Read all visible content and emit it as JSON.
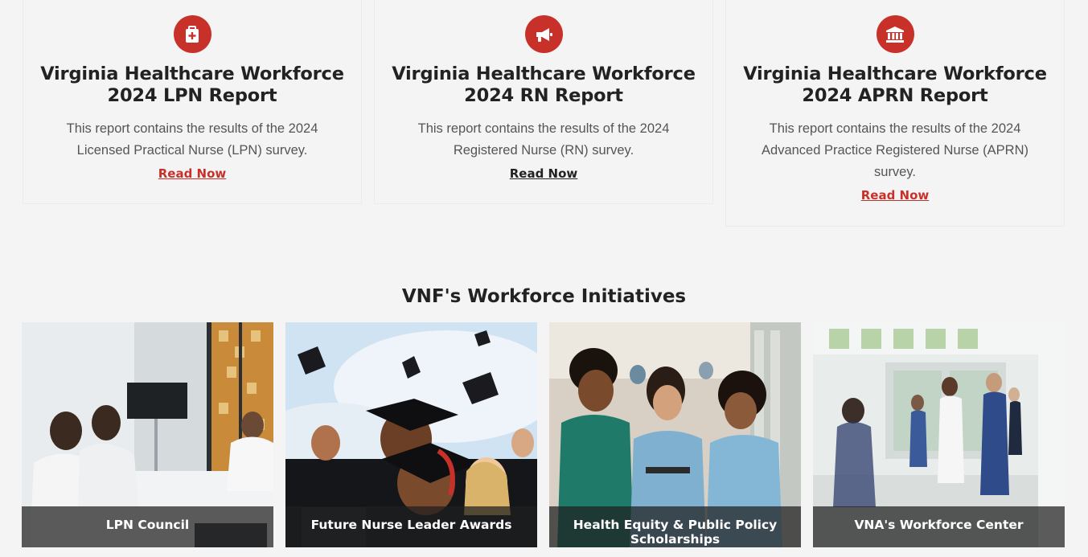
{
  "reports": [
    {
      "icon": "medical-kit-icon",
      "title_line1": "Virginia Healthcare Workforce",
      "title_line2": "2024 LPN Report",
      "description": "This report contains the results of the 2024 Licensed Practical Nurse (LPN) survey.",
      "link_label": "Read Now",
      "link_color": "#c8312a"
    },
    {
      "icon": "megaphone-icon",
      "title_line1": "Virginia Healthcare Workforce",
      "title_line2": "2024 RN Report",
      "description": "This report contains the results of the 2024 Registered Nurse (RN) survey.",
      "link_label": "Read Now",
      "link_color": "#222222"
    },
    {
      "icon": "institution-icon",
      "title_line1": "Virginia Healthcare Workforce",
      "title_line2": "2024 APRN Report",
      "description": "This report contains the results of the 2024 Advanced Practice Registered Nurse (APRN) survey.",
      "link_label": "Read Now",
      "link_color": "#c8312a"
    }
  ],
  "initiatives": {
    "heading": "VNF's Workforce Initiatives",
    "tiles": [
      {
        "label": "LPN Council",
        "image": "meeting-room-photo"
      },
      {
        "label": "Future Nurse Leader Awards",
        "image": "graduation-photo"
      },
      {
        "label": "Health Equity & Public Policy Scholarships",
        "image": "nursing-students-photo"
      },
      {
        "label": "VNA's Workforce Center",
        "image": "hospital-hallway-photo"
      }
    ]
  },
  "colors": {
    "accent": "#c8312a",
    "background": "#f4f4f4",
    "caption_overlay": "rgba(30,30,30,0.72)"
  }
}
